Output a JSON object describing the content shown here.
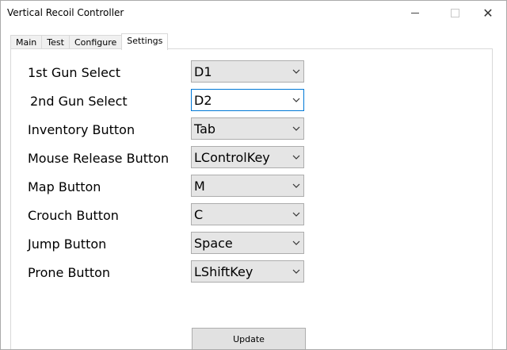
{
  "window": {
    "title": "Vertical Recoil Controller"
  },
  "tabs": [
    {
      "label": "Main",
      "active": false
    },
    {
      "label": "Test",
      "active": false
    },
    {
      "label": "Configure",
      "active": false
    },
    {
      "label": "Settings",
      "active": true
    }
  ],
  "settings": {
    "rows": [
      {
        "label": "1st Gun Select",
        "value": "D1"
      },
      {
        "label": "2nd Gun Select",
        "value": "D2"
      },
      {
        "label": "Inventory Button",
        "value": "Tab"
      },
      {
        "label": "Mouse Release Button",
        "value": "LControlKey"
      },
      {
        "label": "Map Button",
        "value": "M"
      },
      {
        "label": "Crouch Button",
        "value": "C"
      },
      {
        "label": "Jump Button",
        "value": "Space"
      },
      {
        "label": "Prone Button",
        "value": "LShiftKey"
      }
    ],
    "update_label": "Update"
  },
  "icons": {
    "minimize": "minimize-icon",
    "maximize": "maximize-icon",
    "close": "close-icon",
    "dropdown": "chevron-down-icon"
  },
  "colors": {
    "focus_border": "#0078d7",
    "combo_bg": "#e5e5e5"
  }
}
